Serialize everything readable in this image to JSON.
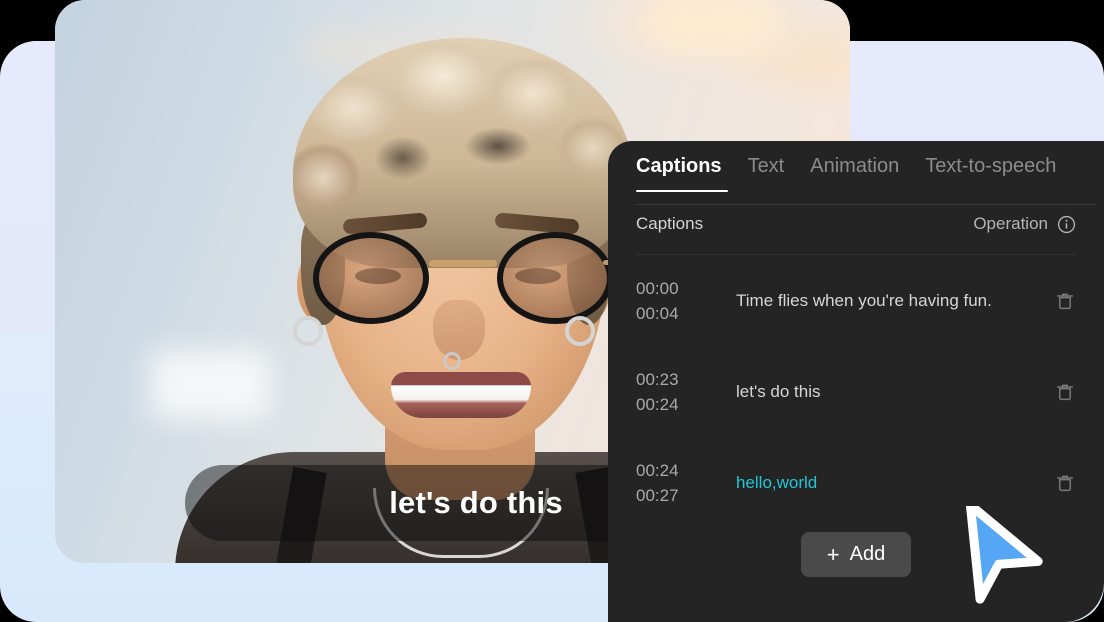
{
  "panel": {
    "tabs": [
      {
        "label": "Captions",
        "active": true
      },
      {
        "label": "Text",
        "active": false
      },
      {
        "label": "Animation",
        "active": false
      },
      {
        "label": "Text-to-speech",
        "active": false
      }
    ],
    "section_label": "Captions",
    "operation_label": "Operation",
    "info_icon": "info-circle-icon",
    "delete_icon": "trash-icon",
    "add_button": {
      "plus": "+",
      "label": "Add"
    },
    "highlight_color": "#23c6d6",
    "captions": [
      {
        "start": "00:00",
        "end": "00:04",
        "text": "Time flies when you're having fun.",
        "highlighted": false
      },
      {
        "start": "00:23",
        "end": "00:24",
        "text": "let's do this",
        "highlighted": false
      },
      {
        "start": "00:24",
        "end": "00:27",
        "text": "hello,world",
        "highlighted": true
      }
    ]
  },
  "preview": {
    "caption_overlay_text": "let's do this"
  },
  "cursor": {
    "icon": "mouse-pointer-icon",
    "fill": "#55a7f5",
    "stroke": "#ffffff"
  },
  "background": {
    "lavender": "#e4e8fb",
    "light_blue": "#d7e9fb",
    "panel_dark": "#242424"
  }
}
